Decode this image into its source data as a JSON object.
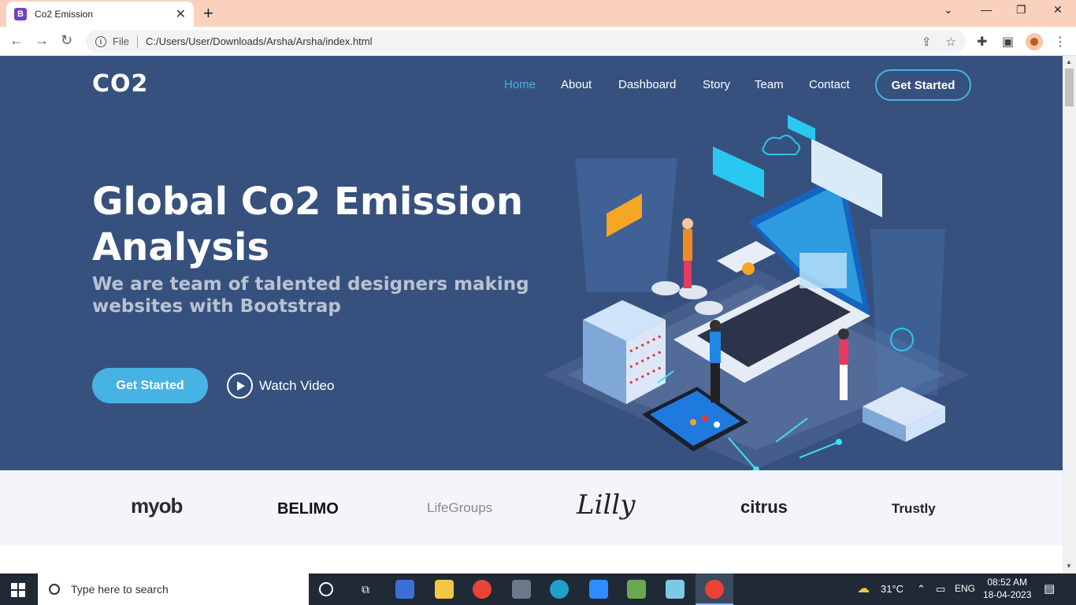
{
  "browser": {
    "tab_title": "Co2 Emission",
    "tab_favicon": "B",
    "address_scheme": "File",
    "address_url": "C:/Users/User/Downloads/Arsha/Arsha/index.html"
  },
  "site": {
    "logo": "CO2",
    "nav": [
      {
        "label": "Home",
        "active": true
      },
      {
        "label": "About"
      },
      {
        "label": "Dashboard"
      },
      {
        "label": "Story"
      },
      {
        "label": "Team"
      },
      {
        "label": "Contact"
      }
    ],
    "nav_cta": "Get Started",
    "hero_title": "Global Co2 Emission Analysis",
    "hero_subtitle": "We are team of talented designers making websites with Bootstrap",
    "cta_primary": "Get Started",
    "cta_video": "Watch Video",
    "clients": [
      "myob",
      "BELIMO",
      "LifeGroups",
      "Lilly",
      "citrus",
      "Trustly"
    ],
    "colors": {
      "hero_bg": "#37517e",
      "accent": "#47b2e4",
      "clients_bg": "#f3f5fa"
    }
  },
  "taskbar": {
    "search_placeholder": "Type here to search",
    "weather": "31°C",
    "language": "ENG",
    "time": "08:52 AM",
    "date": "18-04-2023"
  }
}
